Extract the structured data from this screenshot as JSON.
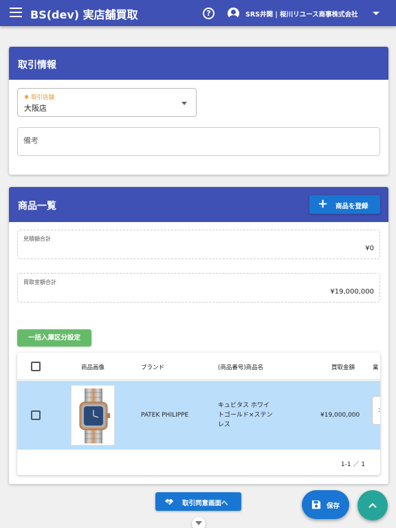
{
  "appbar": {
    "title": "BS(dev) 実店舗買取",
    "help_label": "?",
    "user_name": "SRS井関 | 桜川リユース商事株式会社"
  },
  "trade_info": {
    "title": "取引情報",
    "store_label": "取引店舗",
    "store_required_mark": "✱",
    "store_value": "大阪店",
    "note_placeholder": "備考"
  },
  "product_list": {
    "title": "商品一覧",
    "add_button_label": "商品を登録",
    "estimate_total_label": "見積額合計",
    "estimate_total_value": "¥0",
    "purchase_total_label": "買取金額合計",
    "purchase_total_value": "¥19,000,000",
    "bulk_button_label": "一括入庫区分設定",
    "table": {
      "headers": [
        "商品画像",
        "ブランド",
        "(商品番号)商品名",
        "買取金額",
        "業"
      ],
      "rows": [
        {
          "brand": "PATEK PHILIPPE",
          "name_lines": [
            "キュビタス ホワイ",
            "トゴールド×ステン",
            "レス"
          ],
          "price": "¥19,000,000"
        }
      ],
      "pagination": "1-1 ／ 1"
    }
  },
  "footer": {
    "agree_button_label": "取引同意画面へ",
    "save_button_label": "保存"
  },
  "colors": {
    "primary": "#3f51b5",
    "button_blue": "#1976d2",
    "bulk_green": "#66bb6a",
    "fab_teal": "#26a69a",
    "selected_row": "#bbdefb",
    "required_orange": "#e89a2c"
  },
  "icons": [
    "menu-icon",
    "help-icon",
    "account-icon",
    "chevron-down-icon",
    "plus-icon",
    "handshake-icon",
    "save-icon",
    "arrow-up-icon",
    "scroll-down-icon"
  ]
}
